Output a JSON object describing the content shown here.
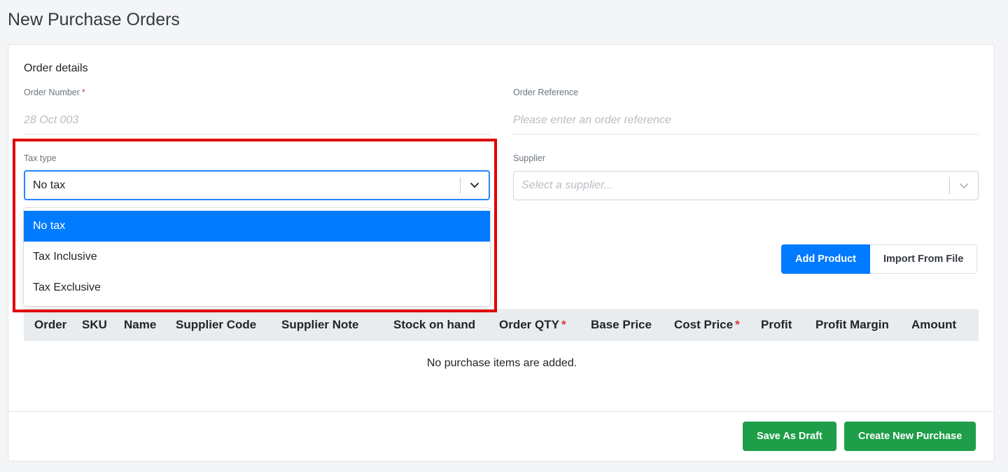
{
  "page_title": "New Purchase Orders",
  "order_details": {
    "section_title": "Order details",
    "order_number": {
      "label": "Order Number",
      "required_mark": "*",
      "placeholder": "28 Oct 003"
    },
    "order_reference": {
      "label": "Order Reference",
      "placeholder": "Please enter an order reference"
    },
    "tax_type": {
      "label": "Tax type",
      "selected": "No tax",
      "options": [
        "No tax",
        "Tax Inclusive",
        "Tax Exclusive"
      ]
    },
    "supplier": {
      "label": "Supplier",
      "placeholder": "Select a supplier..."
    }
  },
  "toolbar": {
    "add_product": "Add Product",
    "import_from_file": "Import From File"
  },
  "table": {
    "columns": [
      "Order",
      "SKU",
      "Name",
      "Supplier Code",
      "Supplier Note",
      "Stock on hand",
      "Order QTY",
      "Base Price",
      "Cost Price",
      "Profit",
      "Profit Margin",
      "Amount"
    ],
    "required_mark": "*",
    "empty_message": "No purchase items are added."
  },
  "footer": {
    "save_draft": "Save As Draft",
    "create_purchase": "Create New Purchase"
  },
  "colors": {
    "primary": "#007bff",
    "success": "#1e9e48",
    "required": "#dc3545",
    "highlight": "#e00000"
  }
}
